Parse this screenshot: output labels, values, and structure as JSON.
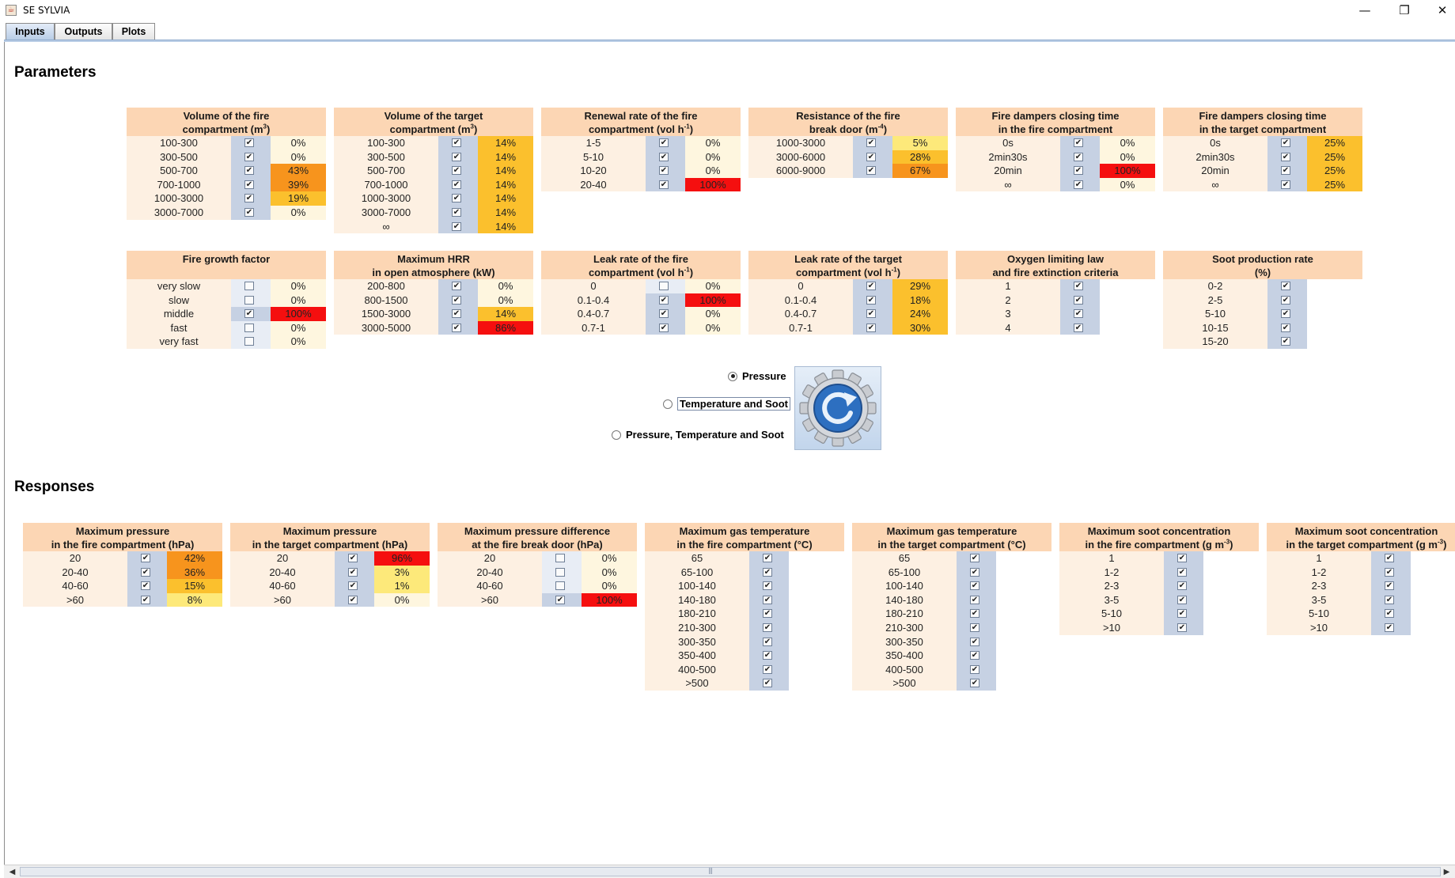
{
  "window": {
    "title": "SE SYLVIA",
    "minimize": "—",
    "restore": "❐",
    "close": "✕"
  },
  "tabs": [
    {
      "label": "Inputs",
      "active": true
    },
    {
      "label": "Outputs",
      "active": false
    },
    {
      "label": "Plots",
      "active": false
    }
  ],
  "sections": {
    "parameters": "Parameters",
    "responses": "Responses"
  },
  "colors": {
    "pct_red": "#f50f0f",
    "pct_orange": "#f7941d",
    "pct_amber": "#fbc02d",
    "pct_yellow": "#fde97a",
    "pct_pale": "#fef6df",
    "header": "#fcd6b4"
  },
  "parameters": [
    {
      "title1": "Volume of the fire",
      "title2": "compartment (m",
      "sup": "3",
      "tail": ")",
      "rows": [
        {
          "label": "100-300",
          "checked": true,
          "value": "0%"
        },
        {
          "label": "300-500",
          "checked": true,
          "value": "0%"
        },
        {
          "label": "500-700",
          "checked": true,
          "value": "43%"
        },
        {
          "label": "700-1000",
          "checked": true,
          "value": "39%"
        },
        {
          "label": "1000-3000",
          "checked": true,
          "value": "19%"
        },
        {
          "label": "3000-7000",
          "checked": true,
          "value": "0%"
        }
      ]
    },
    {
      "title1": "Volume of the target",
      "title2": "compartment (m",
      "sup": "3",
      "tail": ")",
      "rows": [
        {
          "label": "100-300",
          "checked": true,
          "value": "14%"
        },
        {
          "label": "300-500",
          "checked": true,
          "value": "14%"
        },
        {
          "label": "500-700",
          "checked": true,
          "value": "14%"
        },
        {
          "label": "700-1000",
          "checked": true,
          "value": "14%"
        },
        {
          "label": "1000-3000",
          "checked": true,
          "value": "14%"
        },
        {
          "label": "3000-7000",
          "checked": true,
          "value": "14%"
        },
        {
          "label": "∞",
          "checked": true,
          "value": "14%"
        }
      ]
    },
    {
      "title1": "Renewal rate of the fire",
      "title2": "compartment (vol h",
      "sup": "-1",
      "tail": ")",
      "rows": [
        {
          "label": "1-5",
          "checked": true,
          "value": "0%"
        },
        {
          "label": "5-10",
          "checked": true,
          "value": "0%"
        },
        {
          "label": "10-20",
          "checked": true,
          "value": "0%"
        },
        {
          "label": "20-40",
          "checked": true,
          "value": "100%"
        }
      ]
    },
    {
      "title1": "Resistance of the fire",
      "title2": "break door (m",
      "sup": "-4",
      "tail": ")",
      "rows": [
        {
          "label": "1000-3000",
          "checked": true,
          "value": "5%"
        },
        {
          "label": "3000-6000",
          "checked": true,
          "value": "28%"
        },
        {
          "label": "6000-9000",
          "checked": true,
          "value": "67%"
        }
      ]
    },
    {
      "title1": "Fire dampers closing time",
      "title2": "in the fire compartment",
      "sup": "",
      "tail": "",
      "rows": [
        {
          "label": "0s",
          "checked": true,
          "value": "0%"
        },
        {
          "label": "2min30s",
          "checked": true,
          "value": "0%"
        },
        {
          "label": "20min",
          "checked": true,
          "value": "100%"
        },
        {
          "label": "∞",
          "checked": true,
          "value": "0%"
        }
      ]
    },
    {
      "title1": "Fire dampers closing time",
      "title2": "in the target compartment",
      "sup": "",
      "tail": "",
      "rows": [
        {
          "label": "0s",
          "checked": true,
          "value": "25%"
        },
        {
          "label": "2min30s",
          "checked": true,
          "value": "25%"
        },
        {
          "label": "20min",
          "checked": true,
          "value": "25%"
        },
        {
          "label": "∞",
          "checked": true,
          "value": "25%"
        }
      ]
    },
    {
      "title1": "Fire growth factor",
      "title2": "",
      "sup": "",
      "tail": "",
      "rows": [
        {
          "label": "very slow",
          "checked": false,
          "value": "0%"
        },
        {
          "label": "slow",
          "checked": false,
          "value": "0%"
        },
        {
          "label": "middle",
          "checked": true,
          "value": "100%"
        },
        {
          "label": "fast",
          "checked": false,
          "value": "0%"
        },
        {
          "label": "very fast",
          "checked": false,
          "value": "0%"
        }
      ]
    },
    {
      "title1": "Maximum HRR",
      "title2": "in open atmosphere (kW)",
      "sup": "",
      "tail": "",
      "rows": [
        {
          "label": "200-800",
          "checked": true,
          "value": "0%"
        },
        {
          "label": "800-1500",
          "checked": true,
          "value": "0%"
        },
        {
          "label": "1500-3000",
          "checked": true,
          "value": "14%"
        },
        {
          "label": "3000-5000",
          "checked": true,
          "value": "86%"
        }
      ]
    },
    {
      "title1": "Leak rate of the fire",
      "title2": "compartment (vol h",
      "sup": "-1",
      "tail": ")",
      "rows": [
        {
          "label": "0",
          "checked": false,
          "value": "0%"
        },
        {
          "label": "0.1-0.4",
          "checked": true,
          "value": "100%"
        },
        {
          "label": "0.4-0.7",
          "checked": true,
          "value": "0%"
        },
        {
          "label": "0.7-1",
          "checked": true,
          "value": "0%"
        }
      ]
    },
    {
      "title1": "Leak rate of the target",
      "title2": "compartment (vol h",
      "sup": "-1",
      "tail": ")",
      "rows": [
        {
          "label": "0",
          "checked": true,
          "value": "29%"
        },
        {
          "label": "0.1-0.4",
          "checked": true,
          "value": "18%"
        },
        {
          "label": "0.4-0.7",
          "checked": true,
          "value": "24%"
        },
        {
          "label": "0.7-1",
          "checked": true,
          "value": "30%"
        }
      ]
    },
    {
      "title1": "Oxygen limiting law",
      "title2": "and fire extinction criteria",
      "sup": "",
      "tail": "",
      "rows": [
        {
          "label": "1",
          "checked": true,
          "value": ""
        },
        {
          "label": "2",
          "checked": true,
          "value": ""
        },
        {
          "label": "3",
          "checked": true,
          "value": ""
        },
        {
          "label": "4",
          "checked": true,
          "value": ""
        }
      ]
    },
    {
      "title1": "Soot production rate",
      "title2": "(%)",
      "sup": "",
      "tail": "",
      "rows": [
        {
          "label": "0-2",
          "checked": true,
          "value": ""
        },
        {
          "label": "2-5",
          "checked": true,
          "value": ""
        },
        {
          "label": "5-10",
          "checked": true,
          "value": ""
        },
        {
          "label": "10-15",
          "checked": true,
          "value": ""
        },
        {
          "label": "15-20",
          "checked": true,
          "value": ""
        }
      ]
    }
  ],
  "output_choice": {
    "options": [
      {
        "label": "Pressure",
        "selected": true
      },
      {
        "label": "Temperature and Soot",
        "selected": false
      },
      {
        "label": "Pressure, Temperature and Soot",
        "selected": false
      }
    ],
    "run_icon": "refresh-gear-icon"
  },
  "responses": [
    {
      "title1": "Maximum pressure",
      "title2": "in the fire compartment (hPa)",
      "sup": "",
      "tail": "",
      "rows": [
        {
          "label": "20",
          "checked": true,
          "value": "42%"
        },
        {
          "label": "20-40",
          "checked": true,
          "value": "36%"
        },
        {
          "label": "40-60",
          "checked": true,
          "value": "15%"
        },
        {
          "label": ">60",
          "checked": true,
          "value": "8%"
        }
      ]
    },
    {
      "title1": "Maximum pressure",
      "title2": "in the target compartment (hPa)",
      "sup": "",
      "tail": "",
      "rows": [
        {
          "label": "20",
          "checked": true,
          "value": "96%"
        },
        {
          "label": "20-40",
          "checked": true,
          "value": "3%"
        },
        {
          "label": "40-60",
          "checked": true,
          "value": "1%"
        },
        {
          "label": ">60",
          "checked": true,
          "value": "0%"
        }
      ]
    },
    {
      "title1": "Maximum pressure difference",
      "title2": "at the fire break door (hPa)",
      "sup": "",
      "tail": "",
      "rows": [
        {
          "label": "20",
          "checked": false,
          "value": "0%"
        },
        {
          "label": "20-40",
          "checked": false,
          "value": "0%"
        },
        {
          "label": "40-60",
          "checked": false,
          "value": "0%"
        },
        {
          "label": ">60",
          "checked": true,
          "value": "100%"
        }
      ]
    },
    {
      "title1": "Maximum gas temperature",
      "title2": "in the fire compartment (°C)",
      "sup": "",
      "tail": "",
      "rows": [
        {
          "label": "65",
          "checked": true,
          "value": ""
        },
        {
          "label": "65-100",
          "checked": true,
          "value": ""
        },
        {
          "label": "100-140",
          "checked": true,
          "value": ""
        },
        {
          "label": "140-180",
          "checked": true,
          "value": ""
        },
        {
          "label": "180-210",
          "checked": true,
          "value": ""
        },
        {
          "label": "210-300",
          "checked": true,
          "value": ""
        },
        {
          "label": "300-350",
          "checked": true,
          "value": ""
        },
        {
          "label": "350-400",
          "checked": true,
          "value": ""
        },
        {
          "label": "400-500",
          "checked": true,
          "value": ""
        },
        {
          "label": ">500",
          "checked": true,
          "value": ""
        }
      ]
    },
    {
      "title1": "Maximum gas temperature",
      "title2": "in the target compartment (°C)",
      "sup": "",
      "tail": "",
      "rows": [
        {
          "label": "65",
          "checked": true,
          "value": ""
        },
        {
          "label": "65-100",
          "checked": true,
          "value": ""
        },
        {
          "label": "100-140",
          "checked": true,
          "value": ""
        },
        {
          "label": "140-180",
          "checked": true,
          "value": ""
        },
        {
          "label": "180-210",
          "checked": true,
          "value": ""
        },
        {
          "label": "210-300",
          "checked": true,
          "value": ""
        },
        {
          "label": "300-350",
          "checked": true,
          "value": ""
        },
        {
          "label": "350-400",
          "checked": true,
          "value": ""
        },
        {
          "label": "400-500",
          "checked": true,
          "value": ""
        },
        {
          "label": ">500",
          "checked": true,
          "value": ""
        }
      ]
    },
    {
      "title1": "Maximum soot concentration",
      "title2": "in the fire compartment (g m",
      "sup": "-3",
      "tail": ")",
      "rows": [
        {
          "label": "1",
          "checked": true,
          "value": ""
        },
        {
          "label": "1-2",
          "checked": true,
          "value": ""
        },
        {
          "label": "2-3",
          "checked": true,
          "value": ""
        },
        {
          "label": "3-5",
          "checked": true,
          "value": ""
        },
        {
          "label": "5-10",
          "checked": true,
          "value": ""
        },
        {
          "label": ">10",
          "checked": true,
          "value": ""
        }
      ]
    },
    {
      "title1": "Maximum soot concentration",
      "title2": "in the target compartment (g m",
      "sup": "-3",
      "tail": ")",
      "rows": [
        {
          "label": "1",
          "checked": true,
          "value": ""
        },
        {
          "label": "1-2",
          "checked": true,
          "value": ""
        },
        {
          "label": "2-3",
          "checked": true,
          "value": ""
        },
        {
          "label": "3-5",
          "checked": true,
          "value": ""
        },
        {
          "label": "5-10",
          "checked": true,
          "value": ""
        },
        {
          "label": ">10",
          "checked": true,
          "value": ""
        }
      ]
    }
  ]
}
